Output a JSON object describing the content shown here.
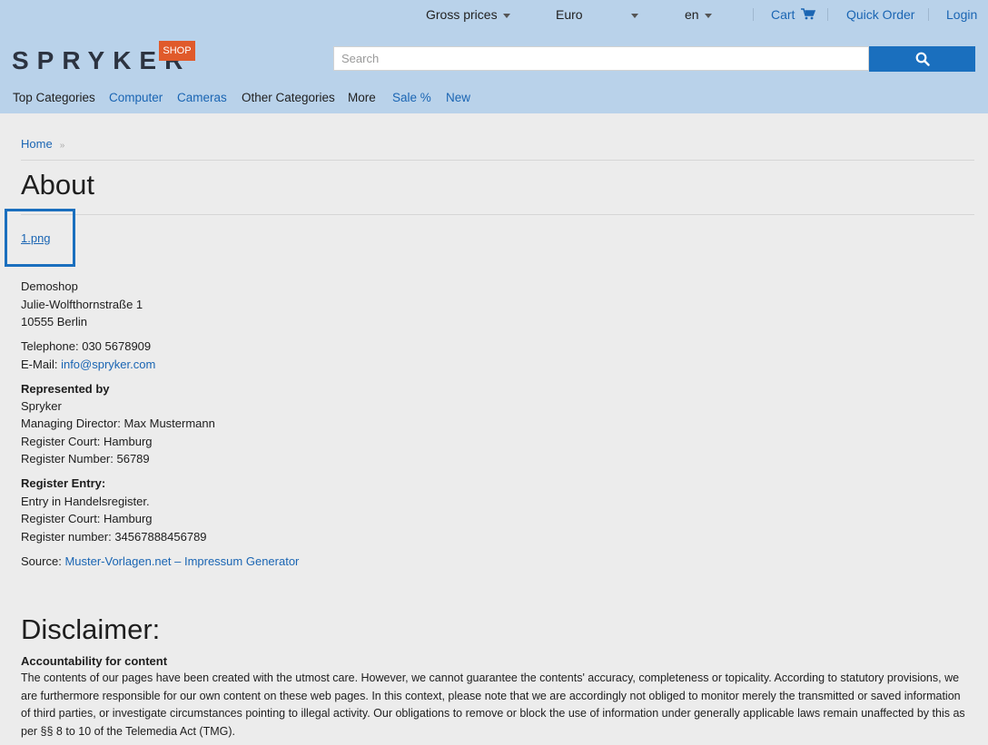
{
  "topbar": {
    "price_mode": "Gross prices",
    "currency": "Euro",
    "language": "en",
    "cart": "Cart",
    "quick_order": "Quick Order",
    "login": "Login"
  },
  "brand": {
    "logo_text": "SPRYKER",
    "badge": "SHOP"
  },
  "search": {
    "placeholder": "Search"
  },
  "nav": {
    "top_categories": "Top Categories",
    "computer": "Computer",
    "cameras": "Cameras",
    "other_categories": "Other Categories",
    "more": "More",
    "sale": "Sale %",
    "new": "New"
  },
  "breadcrumb": {
    "home": "Home",
    "separator": "»"
  },
  "page": {
    "title": "About",
    "image_link": "1.png",
    "address": [
      "Demoshop",
      "Julie-Wolfthornstraße 1",
      "10555 Berlin"
    ],
    "telephone": "Telephone: 030 5678909",
    "email_label": "E-Mail:",
    "email": "info@spryker.com",
    "represented_heading": "Represented by",
    "represented": [
      "Spryker",
      "Managing Director: Max Mustermann",
      "Register Court: Hamburg",
      "Register Number: 56789"
    ],
    "register_heading": "Register Entry:",
    "register": [
      "Entry in Handelsregister.",
      "Register Court: Hamburg",
      "Register number: 34567888456789"
    ],
    "source_label": "Source:",
    "source_link": "Muster-Vorlagen.net – Impressum Generator"
  },
  "disclaimer": {
    "title": "Disclaimer:",
    "accountability_heading": "Accountability for content",
    "accountability_text": "The contents of our pages have been created with the utmost care. However, we cannot guarantee the contents' accuracy, completeness or topicality. According to statutory provisions, we are furthermore responsible for our own content on these web pages. In this context, please note that we are accordingly not obliged to monitor merely the transmitted or saved information of third parties, or investigate circumstances pointing to illegal activity. Our obligations to remove or block the use of information under generally applicable laws remain unaffected by this as per §§ 8 to 10 of the Telemedia Act (TMG)."
  },
  "colors": {
    "header_bg": "#b9d2ea",
    "page_bg": "#ececec",
    "link": "#1a65b3",
    "search_button": "#1a6fbe",
    "badge": "#e05a2b",
    "focus_outline": "#1a6fbe"
  }
}
